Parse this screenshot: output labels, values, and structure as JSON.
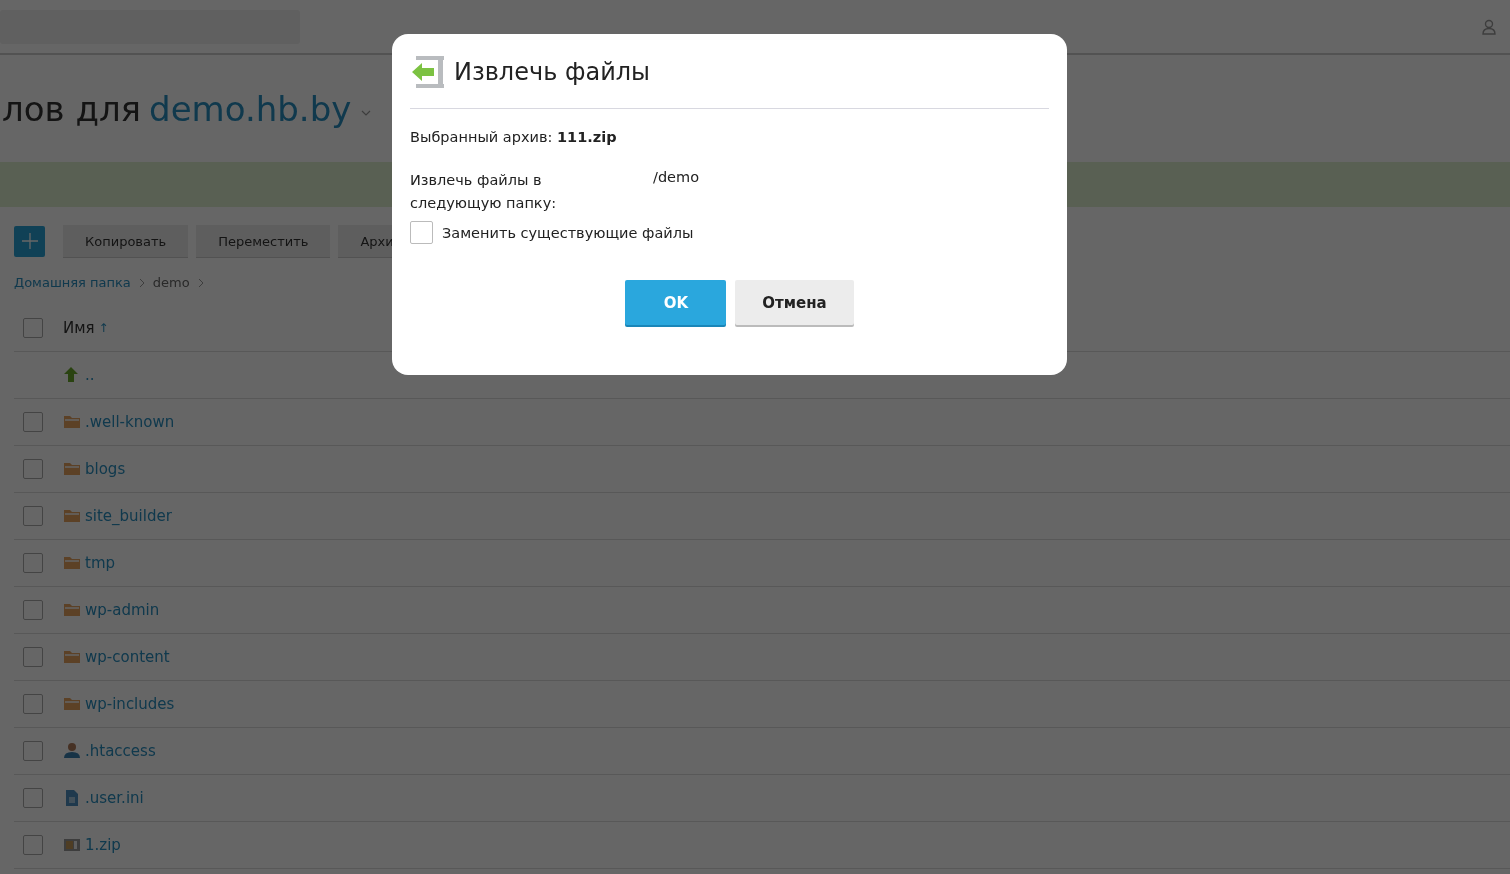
{
  "page_title": {
    "prefix": "лов для",
    "domain": "demo.hb.by"
  },
  "toolbar": {
    "buttons": [
      "Копировать",
      "Переместить",
      "Архи"
    ]
  },
  "breadcrumbs": [
    {
      "label": "Домашняя папка",
      "link": true
    },
    {
      "label": "demo",
      "link": false
    }
  ],
  "table": {
    "header": {
      "label": "Имя",
      "sort": "↑",
      "checked": false
    },
    "rows": [
      {
        "name": "..",
        "kind": "up"
      },
      {
        "name": ".well-known",
        "kind": "folder",
        "checked": false
      },
      {
        "name": "blogs",
        "kind": "folder",
        "checked": false
      },
      {
        "name": "site_builder",
        "kind": "folder",
        "checked": false
      },
      {
        "name": "tmp",
        "kind": "folder",
        "checked": false
      },
      {
        "name": "wp-admin",
        "kind": "folder",
        "checked": false
      },
      {
        "name": "wp-content",
        "kind": "folder",
        "checked": false
      },
      {
        "name": "wp-includes",
        "kind": "folder",
        "checked": false
      },
      {
        "name": ".htaccess",
        "kind": "user",
        "checked": false
      },
      {
        "name": ".user.ini",
        "kind": "doc",
        "checked": false
      },
      {
        "name": "1.zip",
        "kind": "zip",
        "checked": false
      }
    ]
  },
  "dialog": {
    "title": "Извлечь файлы",
    "archive_label": "Выбранный архив:",
    "archive_name": "111.zip",
    "folder_label": "Извлечь файлы в следующую папку:",
    "folder_value": "/demo",
    "replace": {
      "label": "Заменить существующие файлы",
      "checked": false
    },
    "buttons": [
      {
        "label": "OK",
        "kind": "primary"
      },
      {
        "label": "Отмена",
        "kind": "secondary"
      }
    ]
  }
}
